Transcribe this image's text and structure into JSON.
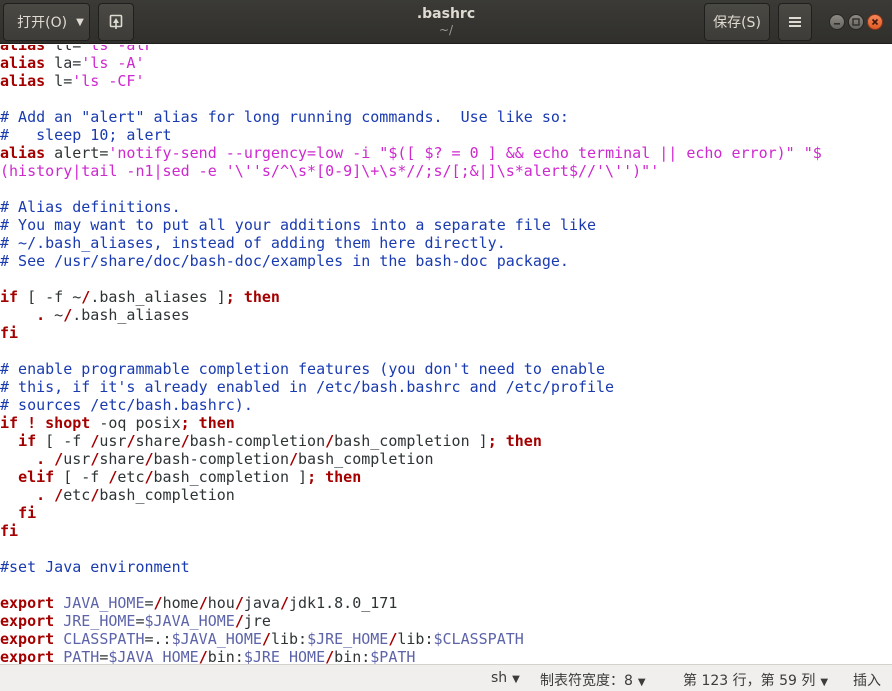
{
  "header": {
    "open_label": "打开(O)",
    "save_label": "保存(S)",
    "title": ".bashrc",
    "subtitle": "~/"
  },
  "icons": {
    "pin": "pin-document-icon",
    "menu": "hamburger-menu-icon",
    "minimize": "minimize-icon",
    "maximize": "maximize-icon",
    "close": "close-icon"
  },
  "syntax_colors": {
    "keyword": "#a40000",
    "string": "#ce28cf",
    "comment": "#1a3bb0",
    "variable": "#5c63a8"
  },
  "editor": {
    "lines": [
      [
        {
          "t": "kw",
          "v": "alias"
        },
        {
          "t": "",
          "v": " ll="
        },
        {
          "t": "str",
          "v": "'ls -alF'"
        }
      ],
      [
        {
          "t": "kw",
          "v": "alias"
        },
        {
          "t": "",
          "v": " la="
        },
        {
          "t": "str",
          "v": "'ls -A'"
        }
      ],
      [
        {
          "t": "kw",
          "v": "alias"
        },
        {
          "t": "",
          "v": " l="
        },
        {
          "t": "str",
          "v": "'ls -CF'"
        }
      ],
      [],
      [
        {
          "t": "cm",
          "v": "# Add an \"alert\" alias for long running commands.  Use like so:"
        }
      ],
      [
        {
          "t": "cm",
          "v": "#   sleep 10; alert"
        }
      ],
      [
        {
          "t": "kw",
          "v": "alias"
        },
        {
          "t": "",
          "v": " alert="
        },
        {
          "t": "str",
          "v": "'notify-send --urgency=low -i \"$([ $? = 0 ] && echo terminal || echo error)\" \"$"
        }
      ],
      [
        {
          "t": "str",
          "v": "(history|tail -n1|sed -e '\\''s/^\\s*[0-9]\\+\\s*//;s/[;&|]\\s*alert$//'\\'')\"'"
        }
      ],
      [],
      [
        {
          "t": "cm",
          "v": "# Alias definitions."
        }
      ],
      [
        {
          "t": "cm",
          "v": "# You may want to put all your additions into a separate file like"
        }
      ],
      [
        {
          "t": "cm",
          "v": "# ~/.bash_aliases, instead of adding them here directly."
        }
      ],
      [
        {
          "t": "cm",
          "v": "# See /usr/share/doc/bash-doc/examples in the bash-doc package."
        }
      ],
      [],
      [
        {
          "t": "kw",
          "v": "if"
        },
        {
          "t": "",
          "v": " [ -f ~"
        },
        {
          "t": "kw",
          "v": "/"
        },
        {
          "t": "",
          "v": ".bash_aliases ]"
        },
        {
          "t": "kw",
          "v": "; then"
        }
      ],
      [
        {
          "t": "",
          "v": "    "
        },
        {
          "t": "kw",
          "v": "."
        },
        {
          "t": "",
          "v": " ~"
        },
        {
          "t": "kw",
          "v": "/"
        },
        {
          "t": "",
          "v": ".bash_aliases"
        }
      ],
      [
        {
          "t": "kw",
          "v": "fi"
        }
      ],
      [],
      [
        {
          "t": "cm",
          "v": "# enable programmable completion features (you don't need to enable"
        }
      ],
      [
        {
          "t": "cm",
          "v": "# this, if it's already enabled in /etc/bash.bashrc and /etc/profile"
        }
      ],
      [
        {
          "t": "cm",
          "v": "# sources /etc/bash.bashrc)."
        }
      ],
      [
        {
          "t": "kw",
          "v": "if ! shopt"
        },
        {
          "t": "",
          "v": " -oq posix"
        },
        {
          "t": "kw",
          "v": "; then"
        }
      ],
      [
        {
          "t": "",
          "v": "  "
        },
        {
          "t": "kw",
          "v": "if"
        },
        {
          "t": "",
          "v": " [ -f "
        },
        {
          "t": "kw",
          "v": "/"
        },
        {
          "t": "",
          "v": "usr"
        },
        {
          "t": "kw",
          "v": "/"
        },
        {
          "t": "",
          "v": "share"
        },
        {
          "t": "kw",
          "v": "/"
        },
        {
          "t": "",
          "v": "bash-completion"
        },
        {
          "t": "kw",
          "v": "/"
        },
        {
          "t": "",
          "v": "bash_completion ]"
        },
        {
          "t": "kw",
          "v": "; then"
        }
      ],
      [
        {
          "t": "",
          "v": "    "
        },
        {
          "t": "kw",
          "v": ". /"
        },
        {
          "t": "",
          "v": "usr"
        },
        {
          "t": "kw",
          "v": "/"
        },
        {
          "t": "",
          "v": "share"
        },
        {
          "t": "kw",
          "v": "/"
        },
        {
          "t": "",
          "v": "bash-completion"
        },
        {
          "t": "kw",
          "v": "/"
        },
        {
          "t": "",
          "v": "bash_completion"
        }
      ],
      [
        {
          "t": "",
          "v": "  "
        },
        {
          "t": "kw",
          "v": "elif"
        },
        {
          "t": "",
          "v": " [ -f "
        },
        {
          "t": "kw",
          "v": "/"
        },
        {
          "t": "",
          "v": "etc"
        },
        {
          "t": "kw",
          "v": "/"
        },
        {
          "t": "",
          "v": "bash_completion ]"
        },
        {
          "t": "kw",
          "v": "; then"
        }
      ],
      [
        {
          "t": "",
          "v": "    "
        },
        {
          "t": "kw",
          "v": ". /"
        },
        {
          "t": "",
          "v": "etc"
        },
        {
          "t": "kw",
          "v": "/"
        },
        {
          "t": "",
          "v": "bash_completion"
        }
      ],
      [
        {
          "t": "",
          "v": "  "
        },
        {
          "t": "kw",
          "v": "fi"
        }
      ],
      [
        {
          "t": "kw",
          "v": "fi"
        }
      ],
      [],
      [
        {
          "t": "cm",
          "v": "#set Java environment"
        }
      ],
      [],
      [
        {
          "t": "kw",
          "v": "export"
        },
        {
          "t": "",
          "v": " "
        },
        {
          "t": "var",
          "v": "JAVA_HOME"
        },
        {
          "t": "",
          "v": "="
        },
        {
          "t": "kw",
          "v": "/"
        },
        {
          "t": "",
          "v": "home"
        },
        {
          "t": "kw",
          "v": "/"
        },
        {
          "t": "",
          "v": "hou"
        },
        {
          "t": "kw",
          "v": "/"
        },
        {
          "t": "",
          "v": "java"
        },
        {
          "t": "kw",
          "v": "/"
        },
        {
          "t": "",
          "v": "jdk1.8.0_171"
        }
      ],
      [
        {
          "t": "kw",
          "v": "export"
        },
        {
          "t": "",
          "v": " "
        },
        {
          "t": "var",
          "v": "JRE_HOME"
        },
        {
          "t": "",
          "v": "="
        },
        {
          "t": "var",
          "v": "$JAVA_HOME"
        },
        {
          "t": "kw",
          "v": "/"
        },
        {
          "t": "",
          "v": "jre"
        }
      ],
      [
        {
          "t": "kw",
          "v": "export"
        },
        {
          "t": "",
          "v": " "
        },
        {
          "t": "var",
          "v": "CLASSPATH"
        },
        {
          "t": "",
          "v": "=.:"
        },
        {
          "t": "var",
          "v": "$JAVA_HOME"
        },
        {
          "t": "kw",
          "v": "/"
        },
        {
          "t": "",
          "v": "lib:"
        },
        {
          "t": "var",
          "v": "$JRE_HOME"
        },
        {
          "t": "kw",
          "v": "/"
        },
        {
          "t": "",
          "v": "lib:"
        },
        {
          "t": "var",
          "v": "$CLASSPATH"
        }
      ],
      [
        {
          "t": "kw",
          "v": "export"
        },
        {
          "t": "",
          "v": " "
        },
        {
          "t": "var",
          "v": "PATH"
        },
        {
          "t": "",
          "v": "="
        },
        {
          "t": "var",
          "v": "$JAVA_HOME"
        },
        {
          "t": "kw",
          "v": "/"
        },
        {
          "t": "",
          "v": "bin:"
        },
        {
          "t": "var",
          "v": "$JRE_HOME"
        },
        {
          "t": "kw",
          "v": "/"
        },
        {
          "t": "",
          "v": "bin:"
        },
        {
          "t": "var",
          "v": "$PATH"
        }
      ]
    ]
  },
  "statusbar": {
    "language": "sh",
    "tab_width": "制表符宽度：8",
    "position": "第 123 行，第 59 列",
    "mode": "插入"
  }
}
